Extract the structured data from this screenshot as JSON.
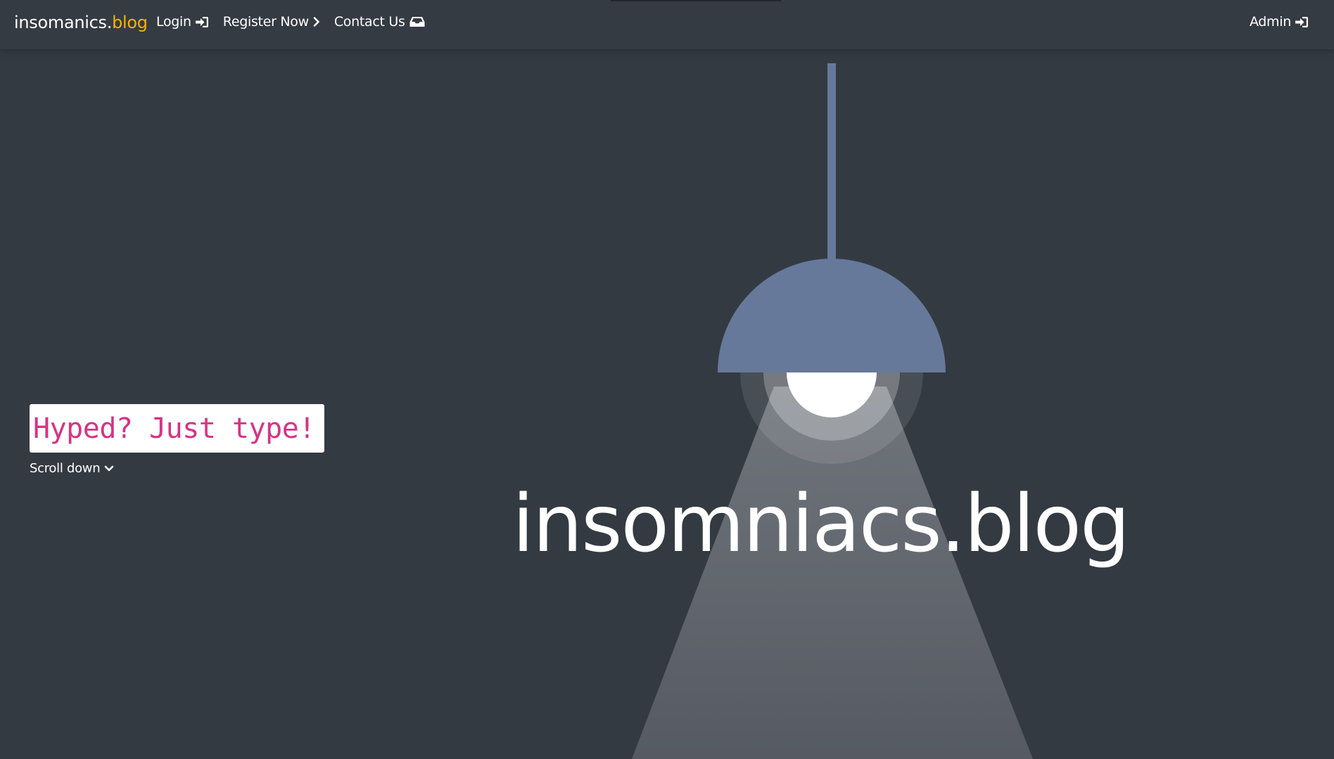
{
  "brand": {
    "name": "insomanics.",
    "accent": "blog",
    "accent_color": "#f3b500"
  },
  "nav": {
    "login": "Login",
    "register": "Register Now",
    "contact": "Contact Us",
    "admin": "Admin"
  },
  "icons": {
    "login": "sign-in-icon",
    "register": "chevron-right-icon",
    "contact": "inbox-icon",
    "admin": "sign-in-icon",
    "scroll": "chevron-down-icon"
  },
  "hero": {
    "tagline": "Hyped? Just type!",
    "tagline_color": "#d63384",
    "scroll_label": "Scroll down",
    "title": "insomniacs.blog"
  },
  "colors": {
    "background": "#343a42",
    "lamp_shade": "#66799b",
    "bulb": "#ffffff"
  }
}
